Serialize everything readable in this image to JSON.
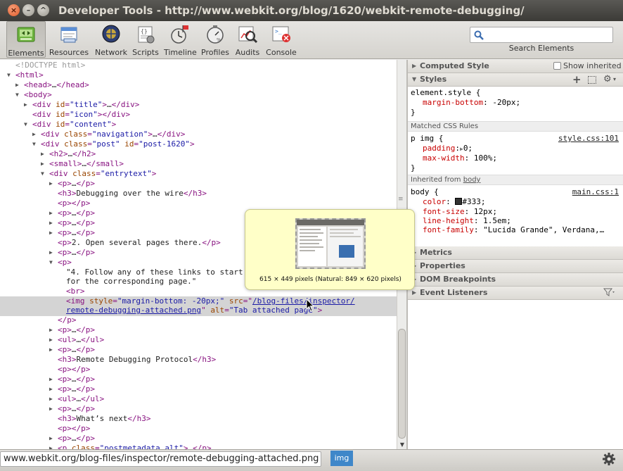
{
  "window": {
    "title": "Developer Tools - http://www.webkit.org/blog/1620/webkit-remote-debugging/",
    "close_glyph": "×",
    "min_glyph": "–",
    "max_glyph": "^"
  },
  "toolbar": {
    "panels": [
      {
        "label": "Elements",
        "icon": "elements-icon",
        "selected": true
      },
      {
        "label": "Resources",
        "icon": "resources-icon"
      },
      {
        "label": "Network",
        "icon": "network-icon"
      },
      {
        "label": "Scripts",
        "icon": "scripts-icon"
      },
      {
        "label": "Timeline",
        "icon": "timeline-icon"
      },
      {
        "label": "Profiles",
        "icon": "profiles-icon"
      },
      {
        "label": "Audits",
        "icon": "audits-icon"
      },
      {
        "label": "Console",
        "icon": "console-icon"
      }
    ],
    "search": {
      "value": "",
      "label": "Search Elements"
    }
  },
  "dom": {
    "doctype": "<!DOCTYPE html>",
    "html_open": "<html>",
    "head": {
      "open": "<head>",
      "ellipsis": "…",
      "close": "</head>"
    },
    "body_open": "<body>",
    "title_div": {
      "open": "<div",
      "attr": "id",
      "val": "\"title\"",
      "rest": ">",
      "ellipsis": "…",
      "close": "</div>"
    },
    "icon_div": {
      "open": "<div",
      "attr": "id",
      "val": "\"icon\"",
      "close": "></div>"
    },
    "content_div": {
      "open": "<div",
      "attr": "id",
      "val": "\"content\"",
      "close": ">"
    },
    "nav_div": {
      "open": "<div",
      "attr": "class",
      "val": "\"navigation\"",
      "rest": ">",
      "ellipsis": "…",
      "close": "</div>"
    },
    "post_div": {
      "open": "<div",
      "attr1": "class",
      "val1": "\"post\"",
      "attr2": "id",
      "val2": "\"post-1620\"",
      "close": ">"
    },
    "h2": {
      "open": "<h2>",
      "ellipsis": "…",
      "close": "</h2>"
    },
    "small": {
      "open": "<small>",
      "ellipsis": "…",
      "close": "</small>"
    },
    "entry_div": {
      "open": "<div",
      "attr": "class",
      "val": "\"entrytext\"",
      "close": ">"
    },
    "p_collapsed": {
      "open": "<p>",
      "ellipsis": "…",
      "close": "</p>"
    },
    "h3_debug": {
      "open": "<h3>",
      "text": "Debugging over the wire",
      "close": "</h3>"
    },
    "p_empty": {
      "open": "<p>",
      "close": "</p>"
    },
    "p2": {
      "open": "<p>",
      "text": "2. Open several pages there.",
      "close": "</p>"
    },
    "p_open": "<p>",
    "p4_text1": "\"4. Follow any of these links to start debugging",
    "p4_text2": "for the corresponding page.\"",
    "br": "<br>",
    "img": {
      "open": "<img",
      "style_attr": "style",
      "style_val": "\"margin-bottom: -20px;\"",
      "src_attr": "src",
      "src_val1": "/blog-files/inspector/",
      "src_val2": "remote-debugging-attached.png",
      "alt_attr": "alt",
      "alt_val": "\"Tab attached page\"",
      "close": ">"
    },
    "p_close": "</p>",
    "ul": {
      "open": "<ul>",
      "ellipsis": "…",
      "close": "</ul>"
    },
    "h3_remote": {
      "open": "<h3>",
      "text": "Remote Debugging Protocol",
      "close": "</h3>"
    },
    "h3_next": {
      "open": "<h3>",
      "text": "What’s next",
      "close": "</h3>"
    },
    "p_meta": {
      "open": "<p",
      "attr": "class",
      "val": "\"postmetadata alt\"",
      "rest": ">",
      "ellipsis": "…",
      "close": "</p>"
    }
  },
  "sidebar": {
    "computed": {
      "label": "Computed Style",
      "checkbox_label": "Show inherited"
    },
    "styles": {
      "label": "Styles"
    },
    "element_style": {
      "selector": "element.style {",
      "prop": "margin-bottom",
      "val": "-20px;",
      "close": "}"
    },
    "matched_label": "Matched CSS Rules",
    "rule1": {
      "selector": "p img {",
      "link": "style.css:101",
      "props": [
        {
          "name": "padding",
          "val": "0;"
        },
        {
          "name": "max-width",
          "val": "100%;"
        }
      ],
      "close": "}"
    },
    "inherited": {
      "prefix": "Inherited from",
      "link": "body"
    },
    "rule2": {
      "selector": "body {",
      "link": "main.css:1",
      "color_name": "color",
      "color_val": "#333;",
      "swatch": "#333333",
      "props": [
        {
          "name": "font-size",
          "val": "12px;"
        },
        {
          "name": "line-height",
          "val": "1.5em;"
        },
        {
          "name": "font-family",
          "val": "\"Lucida Grande\", Verdana,…"
        }
      ],
      "close": "}"
    },
    "metrics": "Metrics",
    "properties": "Properties",
    "dom_breakpoints": "DOM Breakpoints",
    "event_listeners": "Event Listeners"
  },
  "popover": {
    "caption": "615 × 449 pixels (Natural: 849 × 620 pixels)"
  },
  "status": {
    "url": "www.webkit.org/blog-files/inspector/remote-debugging-attached.png",
    "crumb": "img"
  },
  "colors": {
    "tag": "#881280",
    "attr_name": "#994500",
    "attr_value": "#1a1aa6",
    "selected_crumb": "#3f87c9"
  }
}
